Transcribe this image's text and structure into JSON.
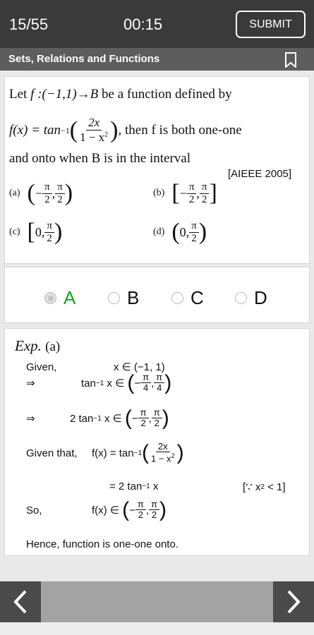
{
  "header": {
    "counter": "15/55",
    "timer": "00:15",
    "submit_label": "SUBMIT"
  },
  "subject": {
    "title": "Sets, Relations and Functions",
    "bookmark_icon": "bookmark-icon"
  },
  "question": {
    "line1": {
      "prefix": "Let ",
      "func": "f :(−1,1)→B",
      "suffix": " be a function defined by"
    },
    "line2": {
      "lhs": "f(x) = tan",
      "sup": "−1",
      "num": "2x",
      "den": "1 − x",
      "den_sup": "2",
      "suffix": ", then f is both one-one"
    },
    "line3": "and onto when B is in the interval",
    "source": "[AIEEE 2005]",
    "options": [
      {
        "label": "(a)",
        "open": "(",
        "left_sign": "−",
        "left_num": "π",
        "left_den": "2",
        "right_num": "π",
        "right_den": "2",
        "close": ")"
      },
      {
        "label": "(b)",
        "open": "[",
        "left_sign": "−",
        "left_num": "π",
        "left_den": "2",
        "right_num": "π",
        "right_den": "2",
        "close": "]"
      },
      {
        "label": "(c)",
        "open": "[",
        "left_value": "0",
        "right_num": "π",
        "right_den": "2",
        "close": ")"
      },
      {
        "label": "(d)",
        "open": "(",
        "left_value": "0",
        "right_num": "π",
        "right_den": "2",
        "close": ")"
      }
    ]
  },
  "choices": [
    {
      "label": "A",
      "selected": true,
      "correct": true
    },
    {
      "label": "B",
      "selected": false,
      "correct": false
    },
    {
      "label": "C",
      "selected": false,
      "correct": false
    },
    {
      "label": "D",
      "selected": false,
      "correct": false
    }
  ],
  "explanation": {
    "title": "Exp.",
    "answer": "(a)",
    "given_label": "Given,",
    "given_value": "x ∈ (−1, 1)",
    "implies": "⇒",
    "step1": {
      "expr": "tan",
      "sup": "−1",
      "var": " x ∈ ",
      "left_sign": "−",
      "num": "π",
      "left_den": "4",
      "right_den": "4"
    },
    "step2": {
      "expr": "2 tan",
      "sup": "−1",
      "var": " x ∈ ",
      "left_sign": "−",
      "num": "π",
      "left_den": "2",
      "right_den": "2"
    },
    "given_that_label": "Given that,",
    "given_that": {
      "lhs": "f(x) = tan",
      "sup": "−1",
      "num": "2x",
      "den": "1 − x",
      "den_sup": "2"
    },
    "equals": {
      "text": "= 2 tan",
      "sup": "−1",
      "var": " x"
    },
    "because": {
      "text": "[∵ x",
      "sup": "2",
      "rest": " < 1]"
    },
    "so_label": "So,",
    "so": {
      "lhs": "f(x) ∈ ",
      "left_sign": "−",
      "num": "π",
      "left_den": "2",
      "right_den": "2"
    },
    "conclusion": "Hence, function is one-one onto."
  },
  "navigation": {
    "prev_icon": "chevron-left-icon",
    "next_icon": "chevron-right-icon"
  },
  "colors": {
    "topbar": "#3a3a3a",
    "subjbar": "#5d5d5d",
    "correct": "#16a816",
    "nav": "#4a4a4a",
    "bottombar": "#a3a3a3"
  }
}
